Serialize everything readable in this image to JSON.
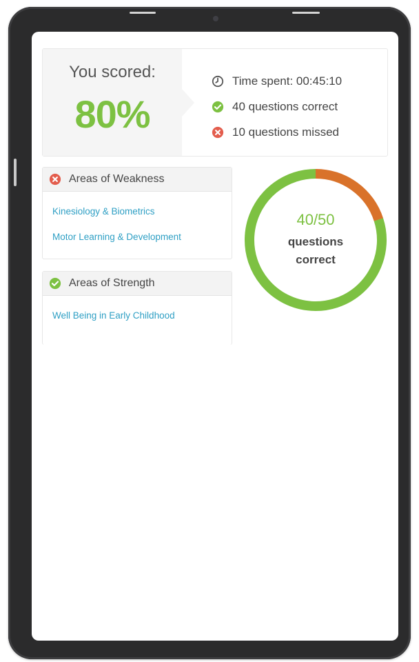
{
  "score": {
    "label": "You scored:",
    "value": "80%"
  },
  "stats": {
    "time_spent": "Time spent: 00:45:10",
    "correct": "40 questions correct",
    "missed": "10 questions missed"
  },
  "weakness": {
    "title": "Areas of Weakness",
    "items": [
      "Kinesiology & Biometrics",
      "Motor Learning & Development"
    ]
  },
  "strength": {
    "title": "Areas of Strength",
    "items": [
      "Well Being in Early Childhood"
    ]
  },
  "donut": {
    "count": "40/50",
    "label_line1": "questions",
    "label_line2": "correct",
    "correct": 40,
    "total": 50
  },
  "colors": {
    "correct": "#7dc142",
    "missed": "#d9722a",
    "error_icon": "#e35d4d",
    "link": "#2e9fc4"
  },
  "icons": {
    "time": "clock-icon",
    "correct": "check-circle-icon",
    "missed": "x-circle-icon"
  }
}
